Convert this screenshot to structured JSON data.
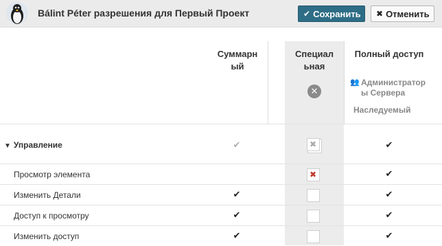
{
  "header": {
    "title": "Bálint Péter разрешения для Первый Проект",
    "save_label": "Сохранить",
    "cancel_label": "Отменить"
  },
  "columns": {
    "summary": "Суммарн ый",
    "special": "Специал ьная",
    "full": "Полный доступ",
    "full_role": "Администратор ы Сервера",
    "full_inherited": "Наследуемый"
  },
  "rows": [
    {
      "label": "Управление",
      "type": "group",
      "summary": "check-light",
      "special": "x-stacked",
      "full": "check"
    },
    {
      "label": "Просмотр элемента",
      "type": "item",
      "summary": "",
      "special": "x-red",
      "full": "check"
    },
    {
      "label": "Изменить Детали",
      "type": "item",
      "summary": "check",
      "special": "empty",
      "full": "check"
    },
    {
      "label": "Доступ к просмотру",
      "type": "item",
      "summary": "check",
      "special": "empty",
      "full": "check"
    },
    {
      "label": "Изменить доступ",
      "type": "item",
      "summary": "check",
      "special": "empty",
      "full": "check"
    }
  ],
  "glyphs": {
    "check": "✔",
    "x": "✖",
    "caret": "▼",
    "user": "👥"
  },
  "colors": {
    "save_button": "#2e6d86",
    "special_column": "#ececec",
    "deny": "#c0392b"
  }
}
